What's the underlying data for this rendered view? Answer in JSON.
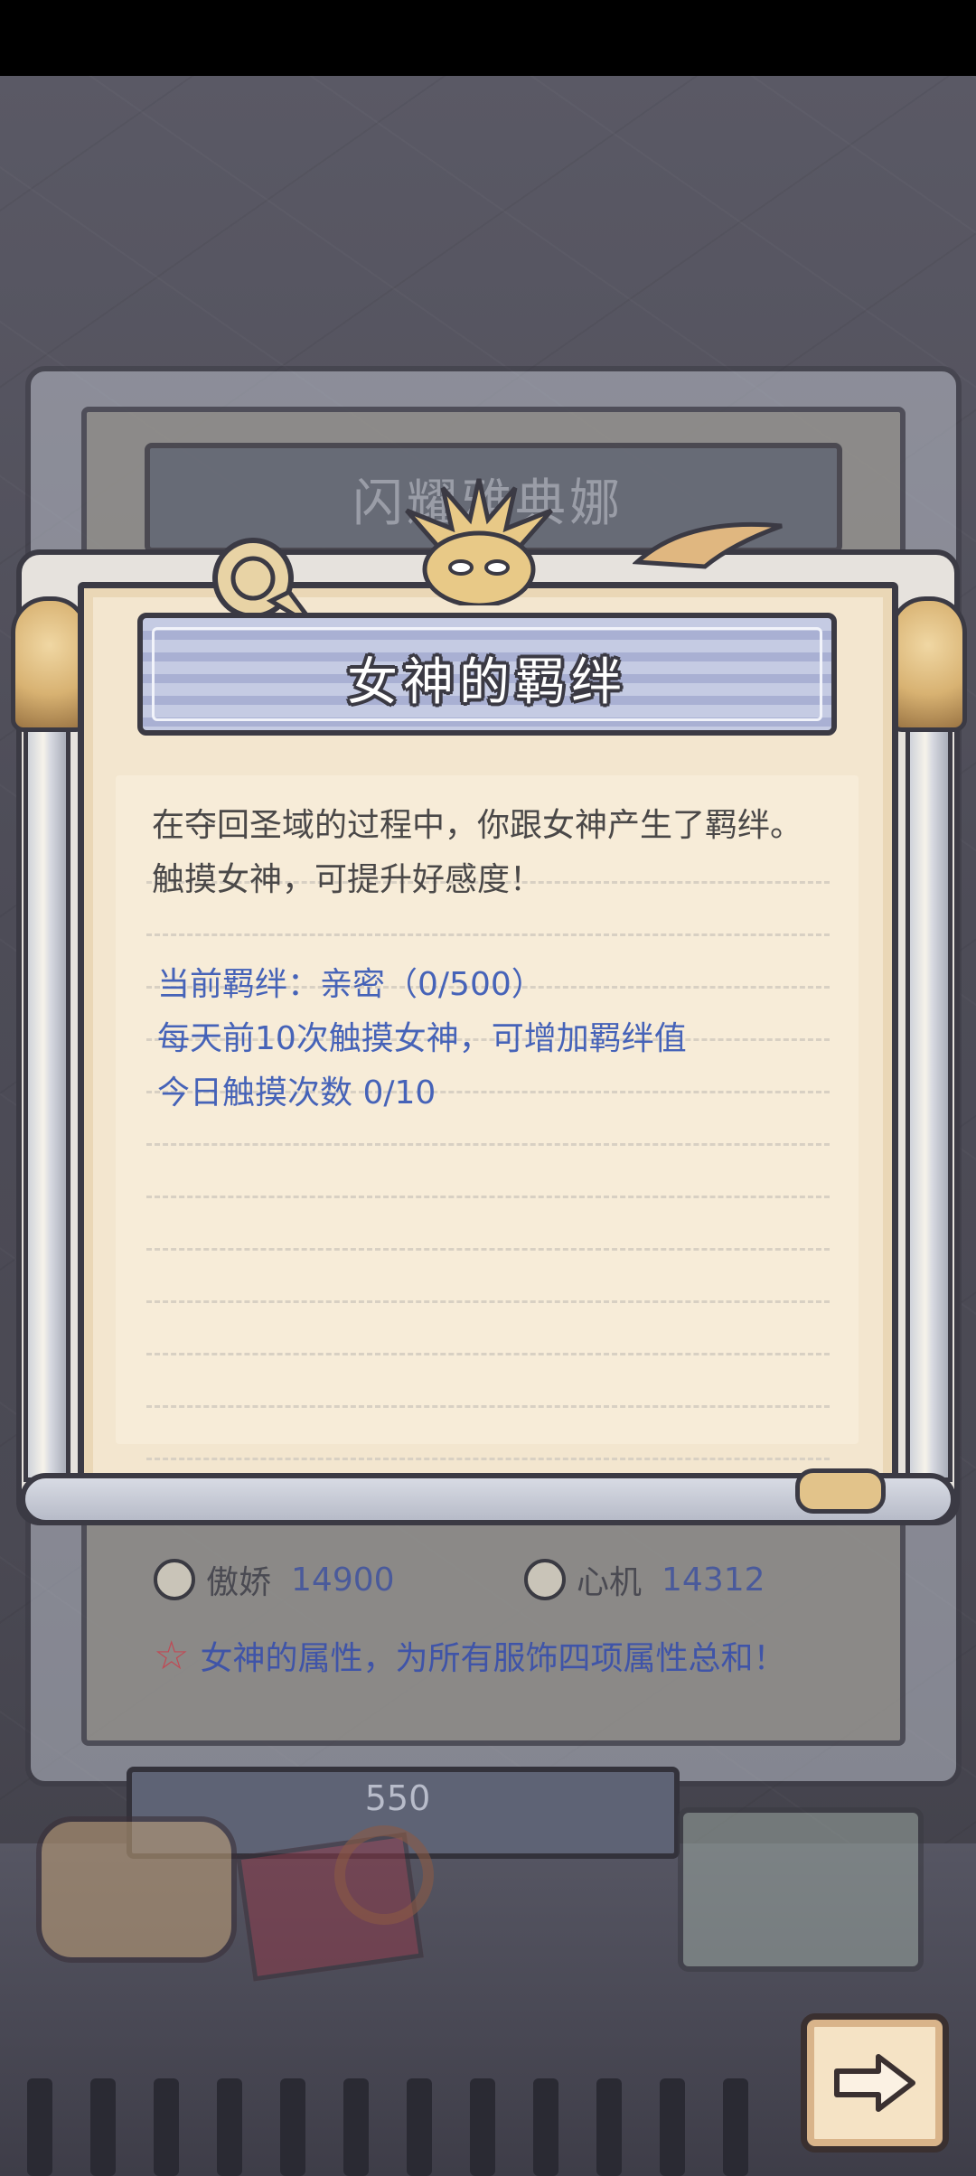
{
  "background": {
    "partial_title": "闪耀雅典娜",
    "stats": [
      {
        "name": "傲娇",
        "value": "14900",
        "icon": "tsundere-icon"
      },
      {
        "name": "心机",
        "value": "14312",
        "icon": "scheming-icon"
      }
    ],
    "attribute_note": "女神的属性，为所有服饰四项属性总和！",
    "bottom_value": "550"
  },
  "dialog": {
    "title": "女神的羁绊",
    "description_line1": "在夺回圣域的过程中，你跟女神产生了羁绊。",
    "description_line2": "触摸女神，可提升好感度！",
    "bond_status": "当前羁绊：亲密（0/500）",
    "bond_rule": "每天前10次触摸女神，可增加羁绊值",
    "touch_count": "今日触摸次数  0/10"
  },
  "colors": {
    "info_text": "#4663b8",
    "description_text": "#4a4848",
    "parchment": "#f3e6cf",
    "title_banner": "#b4bad9"
  },
  "next_button_icon": "arrow-right-icon"
}
